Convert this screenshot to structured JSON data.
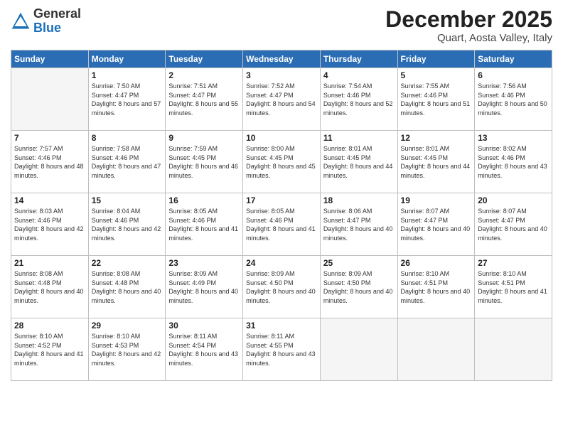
{
  "logo": {
    "general": "General",
    "blue": "Blue"
  },
  "header": {
    "month": "December 2025",
    "location": "Quart, Aosta Valley, Italy"
  },
  "days_of_week": [
    "Sunday",
    "Monday",
    "Tuesday",
    "Wednesday",
    "Thursday",
    "Friday",
    "Saturday"
  ],
  "weeks": [
    [
      {
        "day": "",
        "empty": true
      },
      {
        "day": "1",
        "sunrise": "7:50 AM",
        "sunset": "4:47 PM",
        "daylight": "8 hours and 57 minutes."
      },
      {
        "day": "2",
        "sunrise": "7:51 AM",
        "sunset": "4:47 PM",
        "daylight": "8 hours and 55 minutes."
      },
      {
        "day": "3",
        "sunrise": "7:52 AM",
        "sunset": "4:47 PM",
        "daylight": "8 hours and 54 minutes."
      },
      {
        "day": "4",
        "sunrise": "7:54 AM",
        "sunset": "4:46 PM",
        "daylight": "8 hours and 52 minutes."
      },
      {
        "day": "5",
        "sunrise": "7:55 AM",
        "sunset": "4:46 PM",
        "daylight": "8 hours and 51 minutes."
      },
      {
        "day": "6",
        "sunrise": "7:56 AM",
        "sunset": "4:46 PM",
        "daylight": "8 hours and 50 minutes."
      }
    ],
    [
      {
        "day": "7",
        "sunrise": "7:57 AM",
        "sunset": "4:46 PM",
        "daylight": "8 hours and 48 minutes."
      },
      {
        "day": "8",
        "sunrise": "7:58 AM",
        "sunset": "4:46 PM",
        "daylight": "8 hours and 47 minutes."
      },
      {
        "day": "9",
        "sunrise": "7:59 AM",
        "sunset": "4:45 PM",
        "daylight": "8 hours and 46 minutes."
      },
      {
        "day": "10",
        "sunrise": "8:00 AM",
        "sunset": "4:45 PM",
        "daylight": "8 hours and 45 minutes."
      },
      {
        "day": "11",
        "sunrise": "8:01 AM",
        "sunset": "4:45 PM",
        "daylight": "8 hours and 44 minutes."
      },
      {
        "day": "12",
        "sunrise": "8:01 AM",
        "sunset": "4:45 PM",
        "daylight": "8 hours and 44 minutes."
      },
      {
        "day": "13",
        "sunrise": "8:02 AM",
        "sunset": "4:46 PM",
        "daylight": "8 hours and 43 minutes."
      }
    ],
    [
      {
        "day": "14",
        "sunrise": "8:03 AM",
        "sunset": "4:46 PM",
        "daylight": "8 hours and 42 minutes."
      },
      {
        "day": "15",
        "sunrise": "8:04 AM",
        "sunset": "4:46 PM",
        "daylight": "8 hours and 42 minutes."
      },
      {
        "day": "16",
        "sunrise": "8:05 AM",
        "sunset": "4:46 PM",
        "daylight": "8 hours and 41 minutes."
      },
      {
        "day": "17",
        "sunrise": "8:05 AM",
        "sunset": "4:46 PM",
        "daylight": "8 hours and 41 minutes."
      },
      {
        "day": "18",
        "sunrise": "8:06 AM",
        "sunset": "4:47 PM",
        "daylight": "8 hours and 40 minutes."
      },
      {
        "day": "19",
        "sunrise": "8:07 AM",
        "sunset": "4:47 PM",
        "daylight": "8 hours and 40 minutes."
      },
      {
        "day": "20",
        "sunrise": "8:07 AM",
        "sunset": "4:47 PM",
        "daylight": "8 hours and 40 minutes."
      }
    ],
    [
      {
        "day": "21",
        "sunrise": "8:08 AM",
        "sunset": "4:48 PM",
        "daylight": "8 hours and 40 minutes."
      },
      {
        "day": "22",
        "sunrise": "8:08 AM",
        "sunset": "4:48 PM",
        "daylight": "8 hours and 40 minutes."
      },
      {
        "day": "23",
        "sunrise": "8:09 AM",
        "sunset": "4:49 PM",
        "daylight": "8 hours and 40 minutes."
      },
      {
        "day": "24",
        "sunrise": "8:09 AM",
        "sunset": "4:50 PM",
        "daylight": "8 hours and 40 minutes."
      },
      {
        "day": "25",
        "sunrise": "8:09 AM",
        "sunset": "4:50 PM",
        "daylight": "8 hours and 40 minutes."
      },
      {
        "day": "26",
        "sunrise": "8:10 AM",
        "sunset": "4:51 PM",
        "daylight": "8 hours and 40 minutes."
      },
      {
        "day": "27",
        "sunrise": "8:10 AM",
        "sunset": "4:51 PM",
        "daylight": "8 hours and 41 minutes."
      }
    ],
    [
      {
        "day": "28",
        "sunrise": "8:10 AM",
        "sunset": "4:52 PM",
        "daylight": "8 hours and 41 minutes."
      },
      {
        "day": "29",
        "sunrise": "8:10 AM",
        "sunset": "4:53 PM",
        "daylight": "8 hours and 42 minutes."
      },
      {
        "day": "30",
        "sunrise": "8:11 AM",
        "sunset": "4:54 PM",
        "daylight": "8 hours and 43 minutes."
      },
      {
        "day": "31",
        "sunrise": "8:11 AM",
        "sunset": "4:55 PM",
        "daylight": "8 hours and 43 minutes."
      },
      {
        "day": "",
        "empty": true
      },
      {
        "day": "",
        "empty": true
      },
      {
        "day": "",
        "empty": true
      }
    ]
  ]
}
